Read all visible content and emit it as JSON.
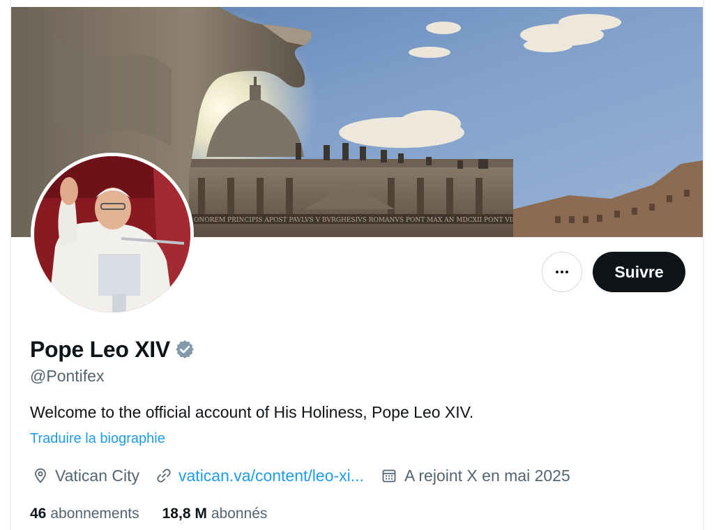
{
  "profile": {
    "display_name": "Pope Leo XIV",
    "handle": "@Pontifex",
    "bio": "Welcome to the official account of His Holiness, Pope Leo XIV.",
    "translate_bio_label": "Traduire la biographie",
    "location": "Vatican City",
    "website": "vatican.va/content/leo-xi...",
    "joined": "A rejoint X en mai 2025",
    "verified": true
  },
  "actions": {
    "more_icon": "ellipsis-icon",
    "follow_label": "Suivre"
  },
  "stats": {
    "following_count": "46",
    "following_label": "abonnements",
    "followers_count": "18,8 M",
    "followers_label": "abonnés"
  },
  "banner": {
    "inscription": "ONOREM PRINCIPIS APOST PAVLVS V BVRGHESIVS ROMANVS PONT MAX AN MDCXII PONT VII"
  },
  "colors": {
    "text_primary": "#0f1419",
    "text_secondary": "#536471",
    "link": "#1d9bf0",
    "follow_bg": "#0f1419",
    "verified": "#829aab"
  }
}
